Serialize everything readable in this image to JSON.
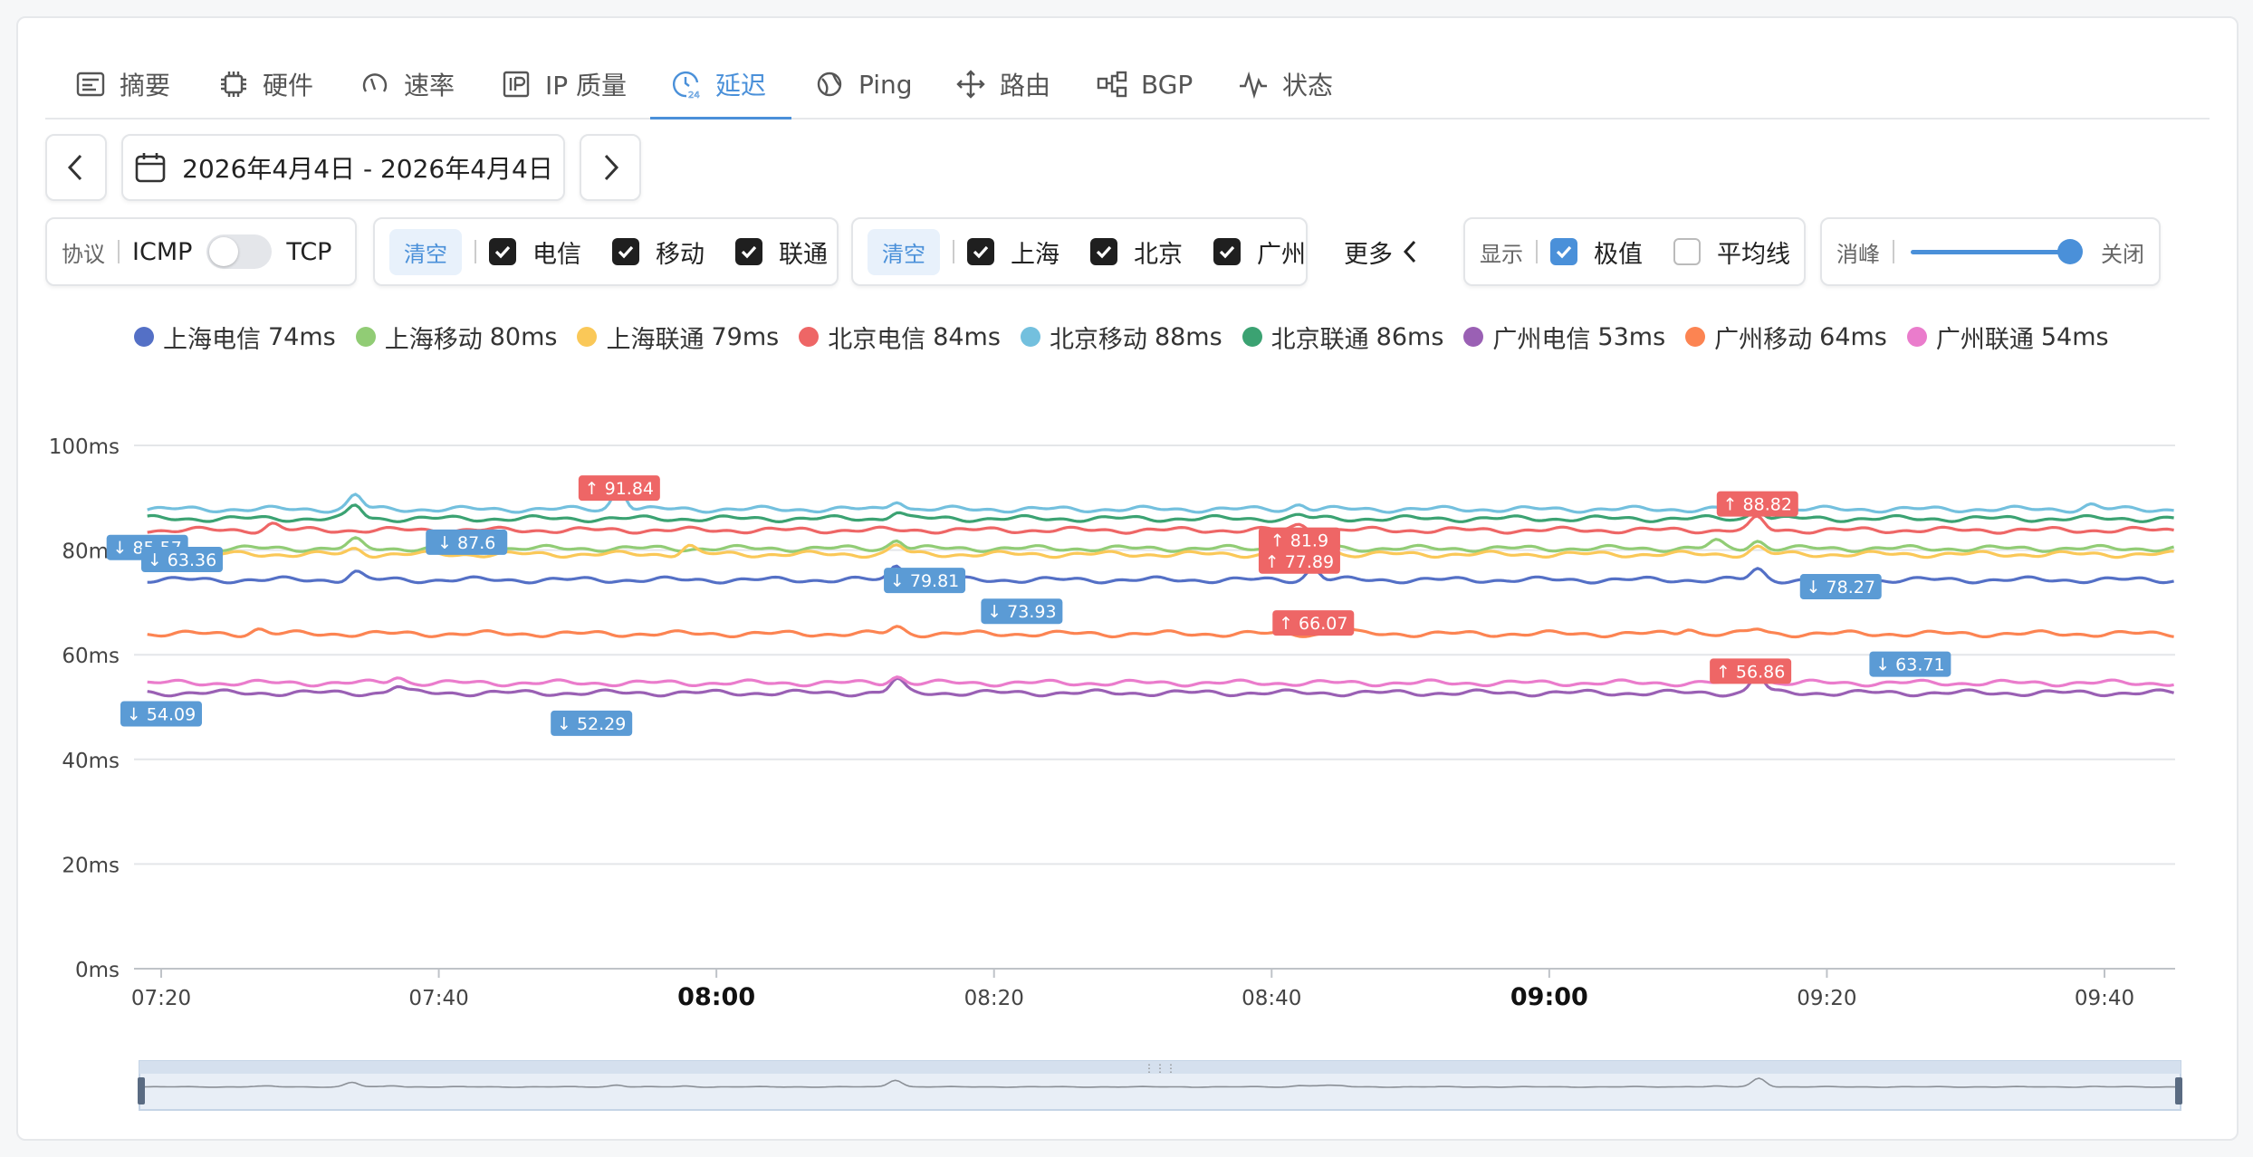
{
  "tabs": [
    {
      "label": "摘要",
      "icon": "summary-icon"
    },
    {
      "label": "硬件",
      "icon": "chip-icon"
    },
    {
      "label": "速率",
      "icon": "speed-icon"
    },
    {
      "label": "IP 质量",
      "icon": "ip-icon"
    },
    {
      "label": "延迟",
      "icon": "clock-icon",
      "active": true
    },
    {
      "label": "Ping",
      "icon": "globe-icon"
    },
    {
      "label": "路由",
      "icon": "route-icon"
    },
    {
      "label": "BGP",
      "icon": "network-icon"
    },
    {
      "label": "状态",
      "icon": "pulse-icon"
    }
  ],
  "date_range": "2026年4月4日 - 2026年4月4日",
  "protocol": {
    "label": "协议",
    "left": "ICMP",
    "right": "TCP"
  },
  "isp_filter": {
    "clear": "清空",
    "items": [
      "电信",
      "移动",
      "联通"
    ]
  },
  "city_filter": {
    "clear": "清空",
    "items": [
      "上海",
      "北京",
      "广州"
    ]
  },
  "more_label": "更多",
  "display": {
    "label": "显示",
    "peak": "极值",
    "avg": "平均线",
    "peak_checked": true,
    "avg_checked": false
  },
  "smoothing": {
    "label": "消峰",
    "value_label": "关闭"
  },
  "legend": [
    {
      "name": "上海电信",
      "value": "74ms",
      "color": "#5470c6"
    },
    {
      "name": "上海移动",
      "value": "80ms",
      "color": "#91cc75"
    },
    {
      "name": "上海联通",
      "value": "79ms",
      "color": "#fac858"
    },
    {
      "name": "北京电信",
      "value": "84ms",
      "color": "#ee6666"
    },
    {
      "name": "北京移动",
      "value": "88ms",
      "color": "#73c0de"
    },
    {
      "name": "北京联通",
      "value": "86ms",
      "color": "#3ba272"
    },
    {
      "name": "广州电信",
      "value": "53ms",
      "color": "#9a60b4"
    },
    {
      "name": "广州移动",
      "value": "64ms",
      "color": "#fc8452"
    },
    {
      "name": "广州联通",
      "value": "54ms",
      "color": "#ea7ccc"
    }
  ],
  "chart_data": {
    "type": "line",
    "y_ticks": [
      "0ms",
      "20ms",
      "40ms",
      "60ms",
      "80ms",
      "100ms"
    ],
    "ylim": [
      0,
      100
    ],
    "x_ticks": [
      {
        "t": 0,
        "label": "07:20",
        "bold": false
      },
      {
        "t": 20,
        "label": "07:40",
        "bold": false
      },
      {
        "t": 40,
        "label": "08:00",
        "bold": true
      },
      {
        "t": 60,
        "label": "08:20",
        "bold": false
      },
      {
        "t": 80,
        "label": "08:40",
        "bold": false
      },
      {
        "t": 100,
        "label": "09:00",
        "bold": true
      },
      {
        "t": 120,
        "label": "09:20",
        "bold": false
      },
      {
        "t": 140,
        "label": "09:40",
        "bold": false
      }
    ],
    "xlim": [
      -2,
      145
    ],
    "series": [
      {
        "name": "上海电信",
        "base": 74.3,
        "spikes": [
          [
            14,
            75.8
          ],
          [
            53,
            77.0
          ],
          [
            83,
            76.5
          ],
          [
            115,
            76.3
          ]
        ]
      },
      {
        "name": "上海移动",
        "base": 80.3,
        "spikes": [
          [
            14,
            81.8
          ],
          [
            53,
            82.0
          ],
          [
            84,
            81.0
          ],
          [
            112,
            81.6
          ],
          [
            115,
            81.8
          ]
        ]
      },
      {
        "name": "上海联通",
        "base": 79.2,
        "spikes": [
          [
            14,
            80.2
          ],
          [
            38,
            80.8
          ],
          [
            53,
            80.9
          ],
          [
            84,
            81.0
          ],
          [
            115,
            80.5
          ]
        ]
      },
      {
        "name": "北京电信",
        "base": 83.8,
        "spikes": [
          [
            8,
            85.0
          ],
          [
            82,
            84.8
          ],
          [
            115,
            86.0
          ]
        ]
      },
      {
        "name": "北京移动",
        "base": 87.8,
        "spikes": [
          [
            14,
            90.5
          ],
          [
            33,
            91.84
          ],
          [
            53,
            89.6
          ],
          [
            82,
            88.8
          ],
          [
            115,
            90.3
          ],
          [
            139,
            88.6
          ]
        ]
      },
      {
        "name": "北京联通",
        "base": 86.0,
        "spikes": [
          [
            14,
            88.5
          ],
          [
            53,
            87.4
          ],
          [
            82,
            86.6
          ],
          [
            115,
            88.0
          ]
        ]
      },
      {
        "name": "广州电信",
        "base": 52.7,
        "spikes": [
          [
            17,
            54.0
          ],
          [
            53,
            55.2
          ],
          [
            115,
            56.0
          ]
        ]
      },
      {
        "name": "广州移动",
        "base": 64.0,
        "spikes": [
          [
            7,
            64.9
          ],
          [
            53,
            65.3
          ],
          [
            85,
            66.07
          ],
          [
            110,
            65.1
          ],
          [
            115,
            64.9
          ]
        ]
      },
      {
        "name": "广州联通",
        "base": 54.6,
        "spikes": [
          [
            17,
            55.8
          ],
          [
            53,
            55.9
          ],
          [
            115,
            56.86
          ]
        ]
      }
    ],
    "extremes": [
      {
        "kind": "max",
        "text": "↑ 91.84",
        "t": 33,
        "v": 91.84,
        "color": "#ee6666"
      },
      {
        "kind": "max",
        "text": "↑ 81.9",
        "t": 82,
        "v": 81.9,
        "color": "#ee6666"
      },
      {
        "kind": "max",
        "text": "↑ 77.89",
        "t": 82,
        "v": 77.89,
        "color": "#ee6666"
      },
      {
        "kind": "max",
        "text": "↑ 66.07",
        "t": 83,
        "v": 66.07,
        "color": "#ee6666"
      },
      {
        "kind": "max",
        "text": "↑ 88.82",
        "t": 115,
        "v": 88.82,
        "color": "#ee6666"
      },
      {
        "kind": "max",
        "text": "↑ 56.86",
        "t": 114.5,
        "v": 56.86,
        "color": "#ee6666"
      },
      {
        "kind": "min",
        "text": "↓ 85.57",
        "t": -1,
        "v": 80.5,
        "color": "#5b9bd5"
      },
      {
        "kind": "min",
        "text": "↓ 63.36",
        "t": 1.5,
        "v": 78.2,
        "color": "#5b9bd5"
      },
      {
        "kind": "min",
        "text": "↓ 87.6",
        "t": 22,
        "v": 81.5,
        "color": "#5b9bd5"
      },
      {
        "kind": "min",
        "text": "↓ 79.81",
        "t": 55,
        "v": 74.2,
        "color": "#5b9bd5"
      },
      {
        "kind": "min",
        "text": "↓ 73.93",
        "t": 62,
        "v": 68.3,
        "color": "#5b9bd5"
      },
      {
        "kind": "min",
        "text": "↓ 78.27",
        "t": 121,
        "v": 73.0,
        "color": "#5b9bd5"
      },
      {
        "kind": "min",
        "text": "↓ 63.71",
        "t": 126,
        "v": 58.2,
        "color": "#5b9bd5"
      },
      {
        "kind": "min",
        "text": "↓ 54.09",
        "t": 0,
        "v": 48.7,
        "color": "#5b9bd5"
      },
      {
        "kind": "min",
        "text": "↓ 52.29",
        "t": 31,
        "v": 46.9,
        "color": "#5b9bd5"
      }
    ]
  }
}
